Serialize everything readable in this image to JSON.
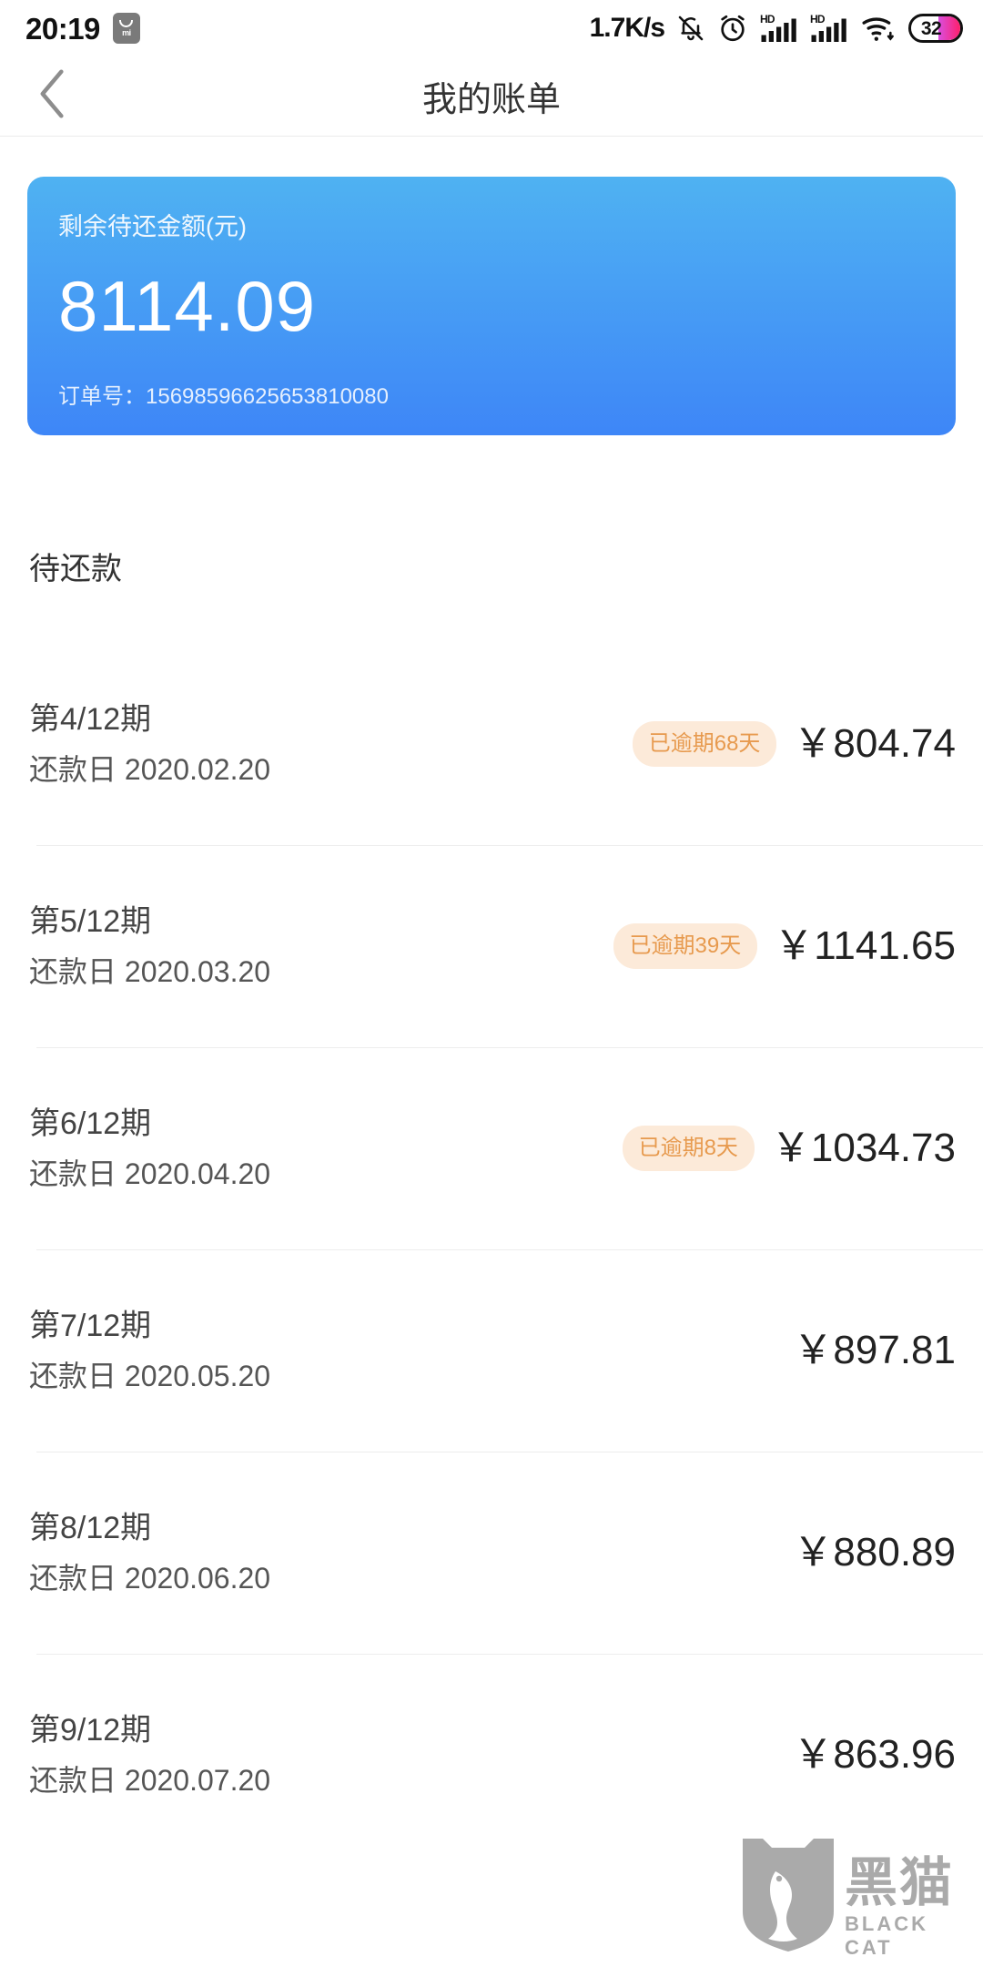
{
  "status_bar": {
    "time": "20:19",
    "brand_badge": "mi",
    "network_speed": "1.7K/s",
    "battery_level": "32",
    "icons": [
      "mi-logo-icon",
      "mute-bell-icon",
      "alarm-clock-icon",
      "hd-signal-icon",
      "hd-signal-icon",
      "wifi-icon",
      "battery-icon"
    ]
  },
  "nav": {
    "back_icon": "chevron-left-icon",
    "title": "我的账单"
  },
  "summary_card": {
    "label": "剩余待还金额(元)",
    "amount": "8114.09",
    "order_label": "订单号：",
    "order_number": "15698596625653810080",
    "gradient_from": "#4fb2f2",
    "gradient_to": "#3e86f7"
  },
  "section": {
    "title": "待还款"
  },
  "bills": [
    {
      "period": "第4/12期",
      "date": "还款日 2020.02.20",
      "badge": "已逾期68天",
      "amount": "￥804.74"
    },
    {
      "period": "第5/12期",
      "date": "还款日 2020.03.20",
      "badge": "已逾期39天",
      "amount": "￥1141.65"
    },
    {
      "period": "第6/12期",
      "date": "还款日 2020.04.20",
      "badge": "已逾期8天",
      "amount": "￥1034.73"
    },
    {
      "period": "第7/12期",
      "date": "还款日 2020.05.20",
      "badge": "",
      "amount": "￥897.81"
    },
    {
      "period": "第8/12期",
      "date": "还款日 2020.06.20",
      "badge": "",
      "amount": "￥880.89"
    },
    {
      "period": "第9/12期",
      "date": "还款日 2020.07.20",
      "badge": "",
      "amount": "￥863.96"
    }
  ],
  "watermark": {
    "cn": "黑猫",
    "en": "BLACK CAT",
    "color": "#8a8a8a"
  },
  "colors": {
    "badge_bg": "#fcead9",
    "badge_text": "#e79a4e",
    "divider": "#ededed"
  }
}
